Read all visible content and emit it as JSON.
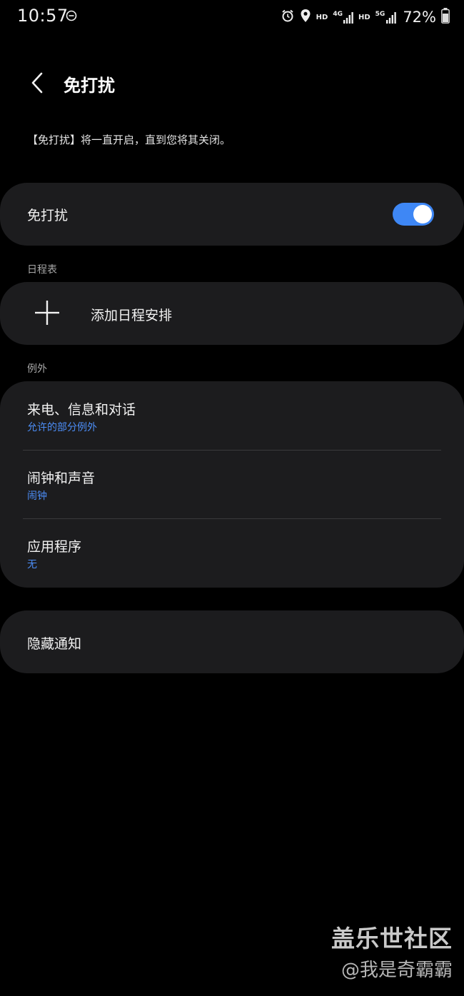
{
  "status_bar": {
    "time": "10:57",
    "hd1": "HD",
    "net1": "4G",
    "hd2": "HD",
    "net2": "5G",
    "battery": "72%",
    "icons": [
      "do-not-disturb-icon",
      "alarm-icon",
      "location-icon",
      "signal-icon",
      "battery-icon"
    ]
  },
  "header": {
    "title": "免打扰",
    "back_icon": "chevron-left-icon"
  },
  "description": "【免打扰】将一直开启，直到您将其关闭。",
  "dnd_toggle": {
    "label": "免打扰",
    "checked": true
  },
  "schedule": {
    "section_label": "日程表",
    "add_label": "添加日程安排",
    "add_icon": "plus-icon"
  },
  "exceptions": {
    "section_label": "例外",
    "items": [
      {
        "title": "来电、信息和对话",
        "subtitle": "允许的部分例外"
      },
      {
        "title": "闹钟和声音",
        "subtitle": "闹钟"
      },
      {
        "title": "应用程序",
        "subtitle": "无"
      }
    ]
  },
  "hide_notifications": {
    "label": "隐藏通知"
  },
  "watermark": {
    "title": "盖乐世社区",
    "author": "@我是奇霸霸"
  },
  "colors": {
    "background": "#000000",
    "card": "#1c1c1e",
    "accent": "#3e87f5",
    "subtitle": "#4c8df6"
  }
}
